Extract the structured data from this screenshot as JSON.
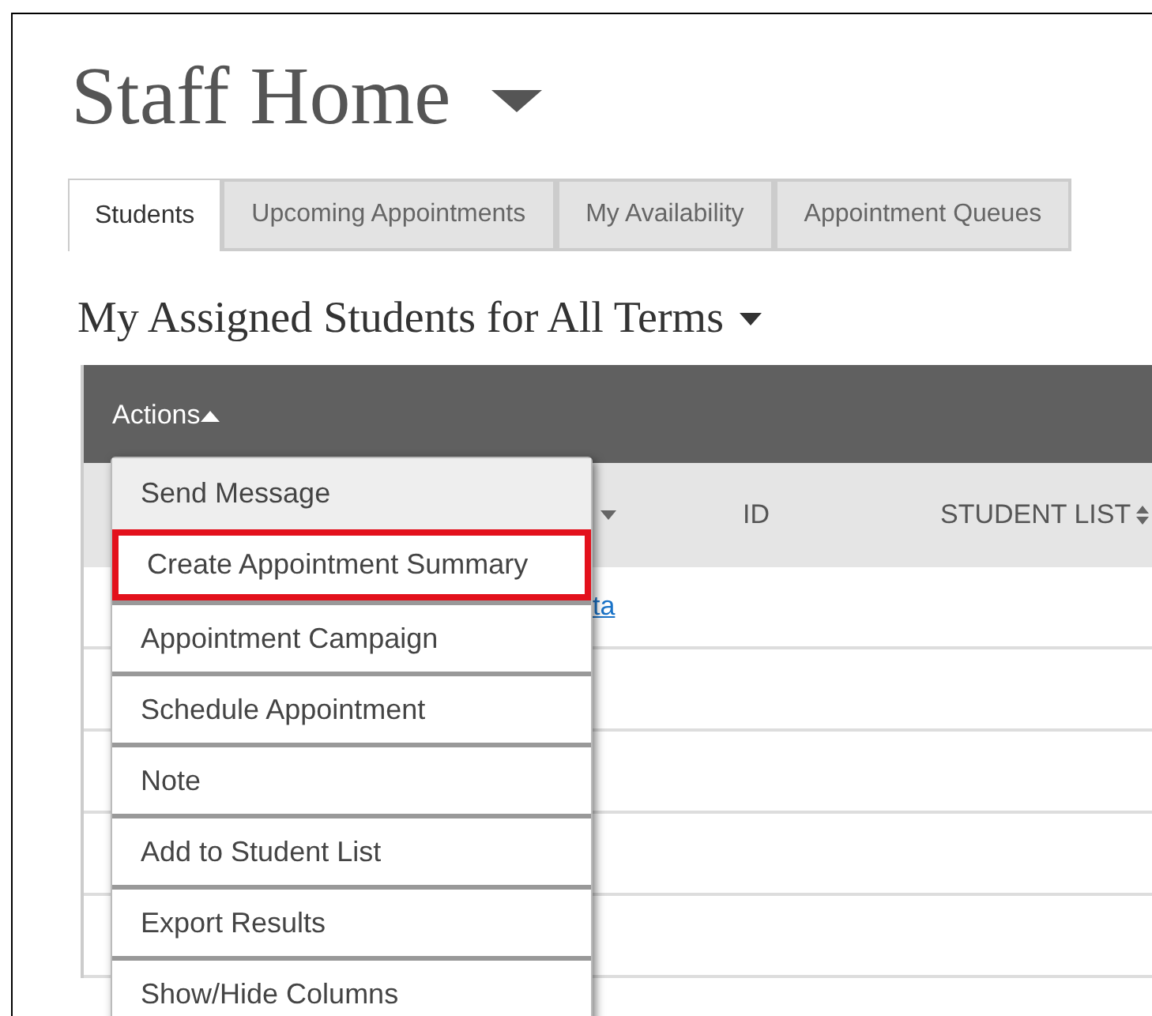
{
  "page": {
    "title": "Staff Home"
  },
  "tabs": [
    {
      "label": "Students",
      "selected": true
    },
    {
      "label": "Upcoming Appointments",
      "selected": false
    },
    {
      "label": "My Availability",
      "selected": false
    },
    {
      "label": "Appointment Queues",
      "selected": false
    }
  ],
  "section": {
    "title": "My Assigned Students for All Terms"
  },
  "table": {
    "actions": {
      "label": "Actions",
      "expanded": true
    },
    "columns": [
      {
        "label": "ID",
        "sortable": false
      },
      {
        "label": "STUDENT LIST",
        "sortable": true
      }
    ],
    "rows": [
      {
        "link": "ta"
      },
      {},
      {},
      {},
      {}
    ]
  },
  "actions_menu": [
    {
      "label": "Send Message",
      "highlighted": true,
      "annotated": false
    },
    {
      "label": "Create Appointment Summary",
      "highlighted": false,
      "annotated": true
    },
    {
      "label": "Appointment Campaign",
      "highlighted": false,
      "annotated": false
    },
    {
      "label": "Schedule Appointment",
      "highlighted": false,
      "annotated": false
    },
    {
      "label": "Note",
      "highlighted": false,
      "annotated": false
    },
    {
      "label": "Add to Student List",
      "highlighted": false,
      "annotated": false
    },
    {
      "label": "Export Results",
      "highlighted": false,
      "annotated": false
    },
    {
      "label": "Show/Hide Columns",
      "highlighted": false,
      "annotated": false
    }
  ]
}
